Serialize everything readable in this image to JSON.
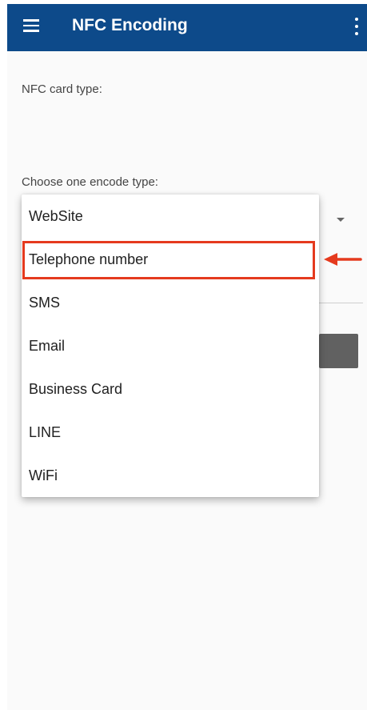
{
  "appbar": {
    "title": "NFC Encoding",
    "menu_icon": "hamburger-menu-icon",
    "overflow_icon": "more-vertical-icon",
    "background_color": "#0d4a8a"
  },
  "content": {
    "card_type_label": "NFC card type:",
    "encode_type_label": "Choose one encode type:"
  },
  "dropdown": {
    "items": [
      "WebSite",
      "Telephone number",
      "SMS",
      "Email",
      "Business Card",
      "LINE",
      "WiFi"
    ],
    "highlighted_item": "Telephone number"
  },
  "annotation": {
    "color": "#e53a1e"
  }
}
